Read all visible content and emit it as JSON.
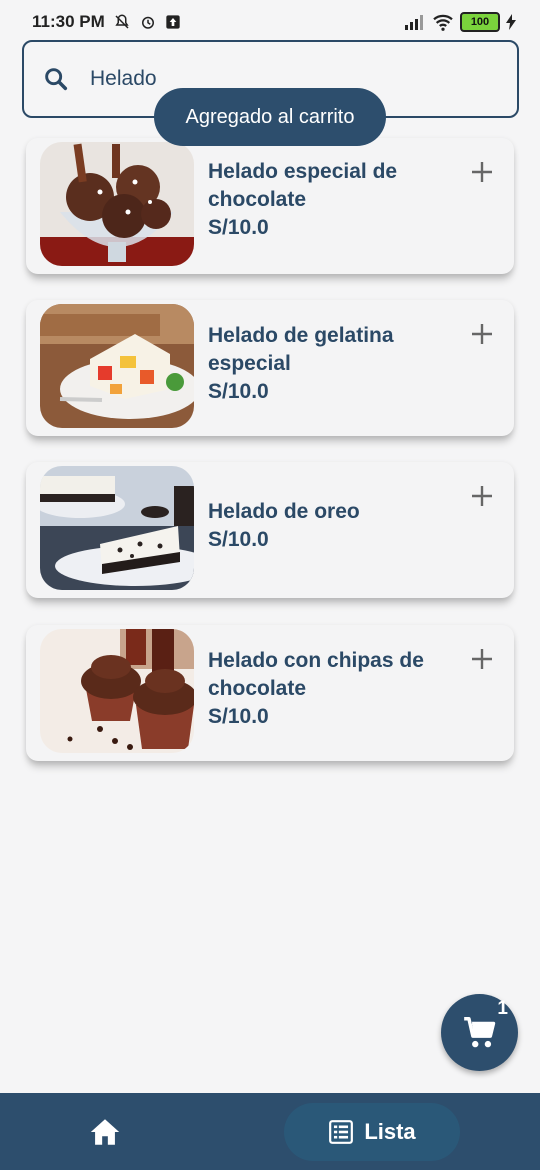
{
  "status_bar": {
    "time": "11:30 PM",
    "battery": "100"
  },
  "search": {
    "value": "Helado"
  },
  "toast": {
    "text": "Agregado al carrito"
  },
  "products": [
    {
      "title": "Helado especial de chocolate",
      "price": "S/10.0",
      "image": "chocolate-ice-cream-image"
    },
    {
      "title": "Helado de gelatina especial",
      "price": "S/10.0",
      "image": "jelly-cake-image"
    },
    {
      "title": "Helado de oreo",
      "price": "S/10.0",
      "image": "oreo-cheesecake-image"
    },
    {
      "title": "Helado con chipas de chocolate",
      "price": "S/10.0",
      "image": "chocolate-cupcakes-image"
    }
  ],
  "cart": {
    "count": "1"
  },
  "bottom_nav": {
    "active_label": "Lista"
  },
  "colors": {
    "primary": "#2d4e6d",
    "text": "#2b4966",
    "background": "#f5f5f6"
  }
}
